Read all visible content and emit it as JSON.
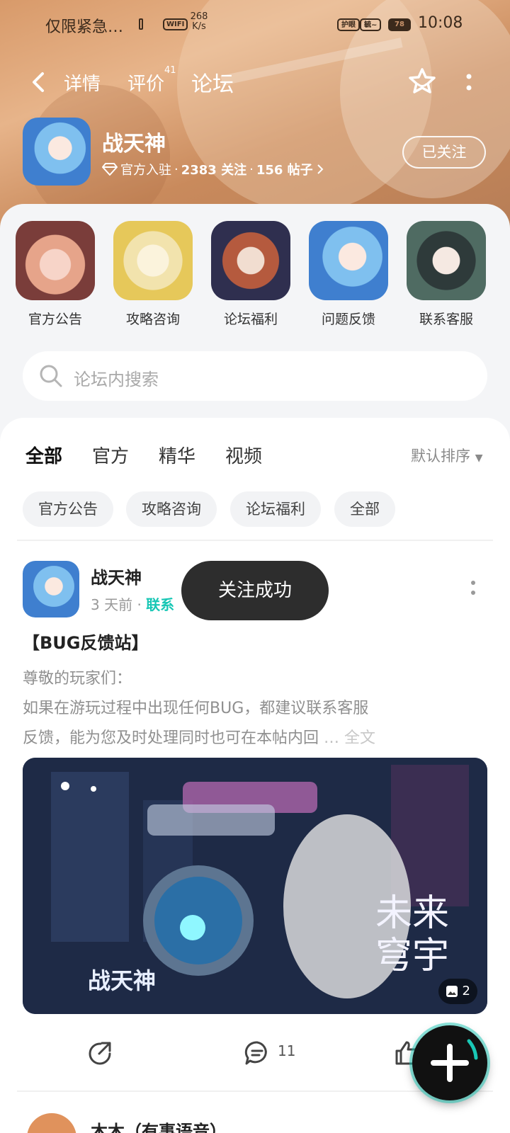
{
  "status_bar": {
    "text_left": "仅限紧急…",
    "wifi_label": "WIFI",
    "speed": "268",
    "speed_unit": "K/s",
    "badge1": "护眼",
    "badge2": "毓~",
    "battery": "78",
    "time": "10:08"
  },
  "nav": {
    "tabs": [
      {
        "label": "详情"
      },
      {
        "label": "评价",
        "badge": "41"
      },
      {
        "label": "论坛"
      }
    ]
  },
  "game": {
    "name": "战天神",
    "official_label": "官方入驻",
    "follow_count": "2383 关注",
    "post_count": "156 帖子",
    "follow_button": "已关注"
  },
  "categories": [
    {
      "label": "官方公告"
    },
    {
      "label": "攻略咨询"
    },
    {
      "label": "论坛福利"
    },
    {
      "label": "问题反馈"
    },
    {
      "label": "联系客服"
    }
  ],
  "search": {
    "placeholder": "论坛内搜索"
  },
  "feed": {
    "tabs": [
      {
        "label": "全部"
      },
      {
        "label": "官方"
      },
      {
        "label": "精华"
      },
      {
        "label": "视频"
      }
    ],
    "sort": "默认排序",
    "chips": [
      {
        "label": "官方公告"
      },
      {
        "label": "攻略咨询"
      },
      {
        "label": "论坛福利"
      },
      {
        "label": "全部"
      }
    ]
  },
  "post": {
    "author": "战天神",
    "time": "3 天前",
    "tag": "联系",
    "title": "【BUG反馈站】",
    "body_line1": "尊敬的玩家们：",
    "body_line2": " 如果在游玩过程中出现任何BUG，都建议联系客服",
    "body_line3": "反馈，能为您及时处理同时也可在本帖内回",
    "ellipsis": "…",
    "read_more": "全文",
    "image_text_game": "战天神",
    "image_text_title": "未来穹宇",
    "image_count": "2",
    "comments": "11"
  },
  "next_post": {
    "author": "木木（有事语音）"
  },
  "toast": "关注成功",
  "colors": {
    "accent": "#19c7b5",
    "toast_bg": "#2d2d2d"
  }
}
